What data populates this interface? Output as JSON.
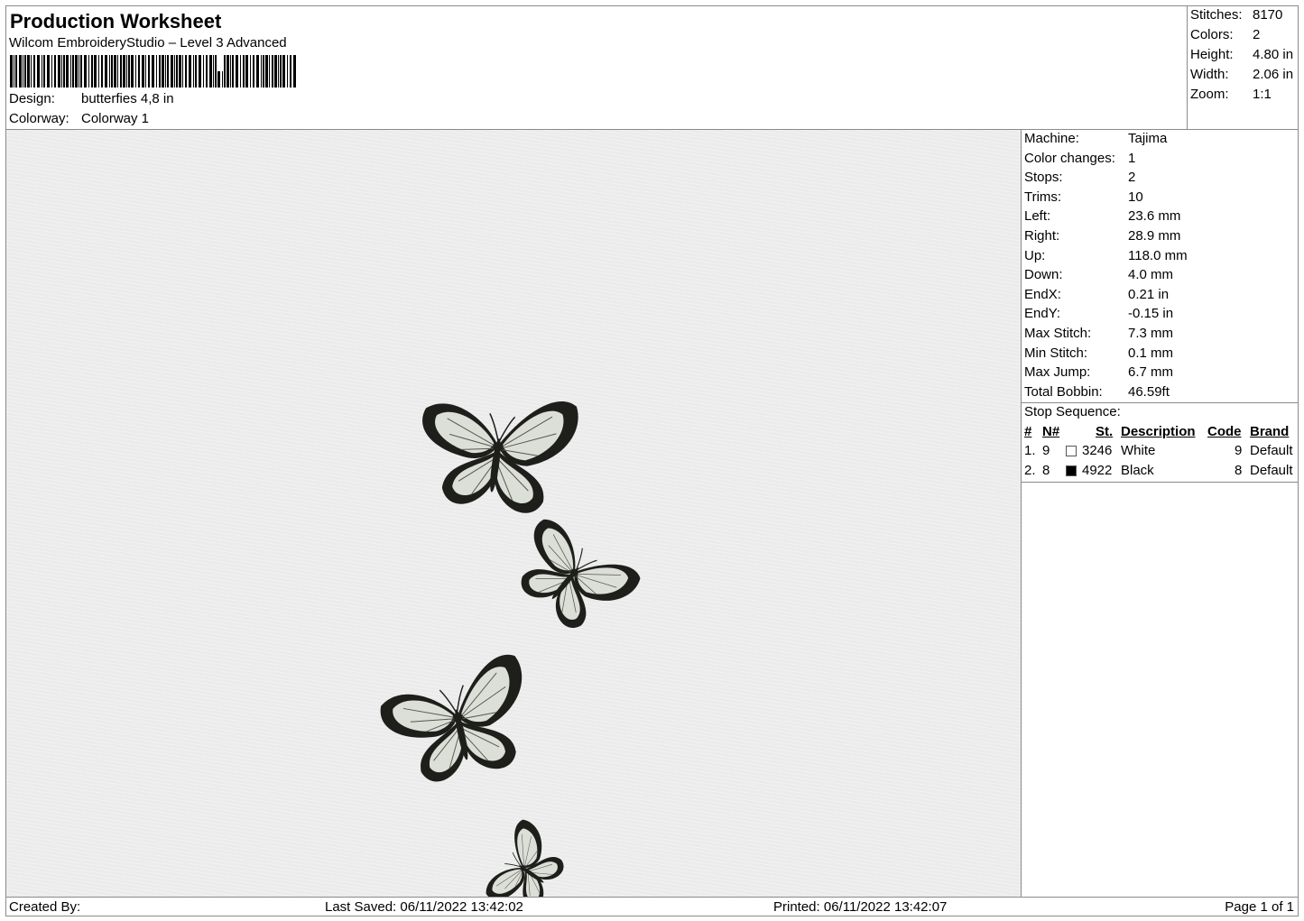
{
  "header": {
    "title": "Production Worksheet",
    "subtitle": "Wilcom EmbroideryStudio – Level 3 Advanced",
    "design_label": "Design:",
    "design_value": "butterfies 4,8 in",
    "colorway_label": "Colorway:",
    "colorway_value": "Colorway 1"
  },
  "summary": [
    {
      "label": "Stitches:",
      "value": "8170"
    },
    {
      "label": "Colors:",
      "value": "2"
    },
    {
      "label": "Height:",
      "value": "4.80 in"
    },
    {
      "label": "Width:",
      "value": "2.06 in"
    },
    {
      "label": "Zoom:",
      "value": "1:1"
    }
  ],
  "params": [
    {
      "label": "Machine:",
      "value": "Tajima"
    },
    {
      "label": "Color changes:",
      "value": "1"
    },
    {
      "label": "Stops:",
      "value": "2"
    },
    {
      "label": "Trims:",
      "value": "10"
    },
    {
      "label": "Left:",
      "value": "23.6 mm"
    },
    {
      "label": "Right:",
      "value": "28.9 mm"
    },
    {
      "label": "Up:",
      "value": "118.0 mm"
    },
    {
      "label": "Down:",
      "value": "4.0 mm"
    },
    {
      "label": "EndX:",
      "value": "0.21 in"
    },
    {
      "label": "EndY:",
      "value": "-0.15 in"
    },
    {
      "label": "Max Stitch:",
      "value": "7.3 mm"
    },
    {
      "label": "Min Stitch:",
      "value": "0.1 mm"
    },
    {
      "label": "Max Jump:",
      "value": "6.7 mm"
    },
    {
      "label": "Total Bobbin:",
      "value": "46.59ft"
    }
  ],
  "stop_sequence": {
    "title": "Stop Sequence:",
    "headers": {
      "num": "#",
      "n": "N#",
      "st": "St.",
      "description": "Description",
      "code": "Code",
      "brand": "Brand"
    },
    "rows": [
      {
        "num": "1.",
        "n": "9",
        "swatch": "#ffffff",
        "st": "3246",
        "description": "White",
        "code": "9",
        "brand": "Default"
      },
      {
        "num": "2.",
        "n": "8",
        "swatch": "#000000",
        "st": "4922",
        "description": "Black",
        "code": "8",
        "brand": "Default"
      }
    ]
  },
  "footer": {
    "created_by": "Created By:",
    "last_saved": "Last Saved: 06/11/2022 13:42:02",
    "printed": "Printed: 06/11/2022 13:42:07",
    "page": "Page 1 of 1"
  },
  "colors": {
    "wing_dark": "#1e1f1b",
    "wing_light": "#dcdfd8",
    "canvas": "#ebebeb"
  }
}
